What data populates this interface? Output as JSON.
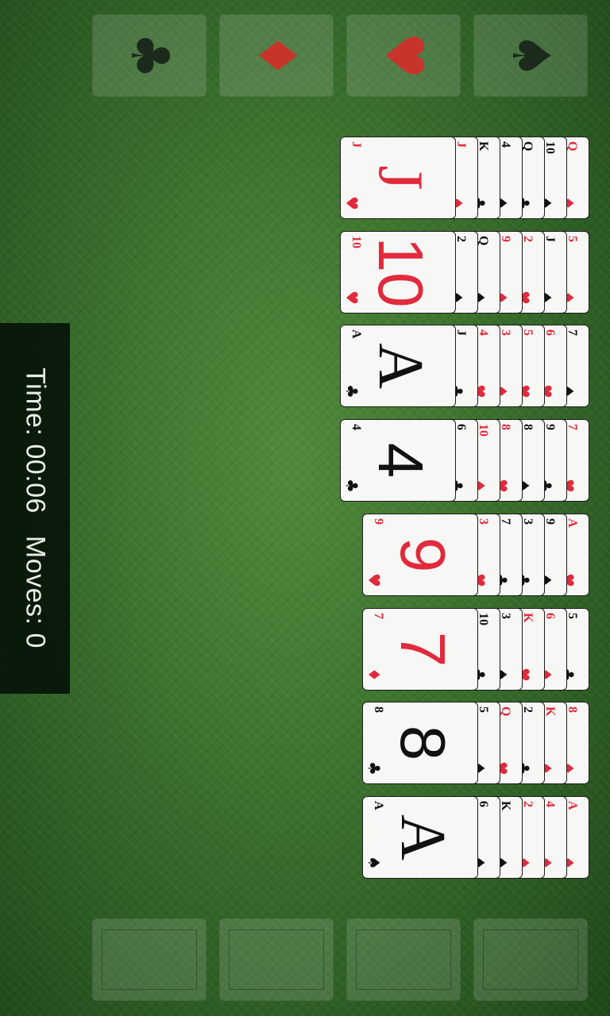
{
  "colors": {
    "red": "#e12a3c",
    "black": "#111111"
  },
  "status": {
    "time_label": "Time: 00:06",
    "moves_label": "Moves: 0"
  },
  "foundations": [
    {
      "suit": "clubs",
      "glyph": "♣",
      "color": "#1b2a1b"
    },
    {
      "suit": "diamonds",
      "glyph": "♦",
      "color": "#c8342b"
    },
    {
      "suit": "hearts",
      "glyph": "♥",
      "color": "#c8342b"
    },
    {
      "suit": "spades",
      "glyph": "♠",
      "color": "#1b2a1b"
    }
  ],
  "freecells": [
    {
      "empty": true
    },
    {
      "empty": true
    },
    {
      "empty": true
    },
    {
      "empty": true
    }
  ],
  "columns": [
    {
      "cards": [
        [
          "Q",
          "♦"
        ],
        [
          "10",
          "♠"
        ],
        [
          "Q",
          "♣"
        ],
        [
          "4",
          "♠"
        ],
        [
          "K",
          "♣"
        ],
        [
          "J",
          "♦"
        ],
        [
          "J",
          "♥"
        ]
      ]
    },
    {
      "cards": [
        [
          "5",
          "♦"
        ],
        [
          "J",
          "♠"
        ],
        [
          "2",
          "♥"
        ],
        [
          "9",
          "♦"
        ],
        [
          "Q",
          "♠"
        ],
        [
          "2",
          "♠"
        ],
        [
          "10",
          "♥"
        ]
      ]
    },
    {
      "cards": [
        [
          "7",
          "♠"
        ],
        [
          "6",
          "♥"
        ],
        [
          "5",
          "♥"
        ],
        [
          "3",
          "♦"
        ],
        [
          "4",
          "♥"
        ],
        [
          "J",
          "♣"
        ],
        [
          "A",
          "♣"
        ]
      ]
    },
    {
      "cards": [
        [
          "7",
          "♥"
        ],
        [
          "9",
          "♣"
        ],
        [
          "8",
          "♠"
        ],
        [
          "8",
          "♥"
        ],
        [
          "10",
          "♦"
        ],
        [
          "6",
          "♣"
        ],
        [
          "4",
          "♣"
        ]
      ]
    },
    {
      "cards": [
        [
          "A",
          "♥"
        ],
        [
          "9",
          "♠"
        ],
        [
          "3",
          "♣"
        ],
        [
          "7",
          "♣"
        ],
        [
          "3",
          "♥"
        ],
        [
          "9",
          "♥"
        ]
      ]
    },
    {
      "cards": [
        [
          "5",
          "♣"
        ],
        [
          "6",
          "♦"
        ],
        [
          "K",
          "♥"
        ],
        [
          "3",
          "♠"
        ],
        [
          "10",
          "♣"
        ],
        [
          "7",
          "♦"
        ]
      ]
    },
    {
      "cards": [
        [
          "8",
          "♦"
        ],
        [
          "K",
          "♦"
        ],
        [
          "2",
          "♣"
        ],
        [
          "Q",
          "♥"
        ],
        [
          "5",
          "♠"
        ],
        [
          "8",
          "♣"
        ]
      ]
    },
    {
      "cards": [
        [
          "A",
          "♦"
        ],
        [
          "4",
          "♦"
        ],
        [
          "2",
          "♦"
        ],
        [
          "K",
          "♠"
        ],
        [
          "6",
          "♠"
        ],
        [
          "A",
          "♠"
        ]
      ]
    }
  ]
}
